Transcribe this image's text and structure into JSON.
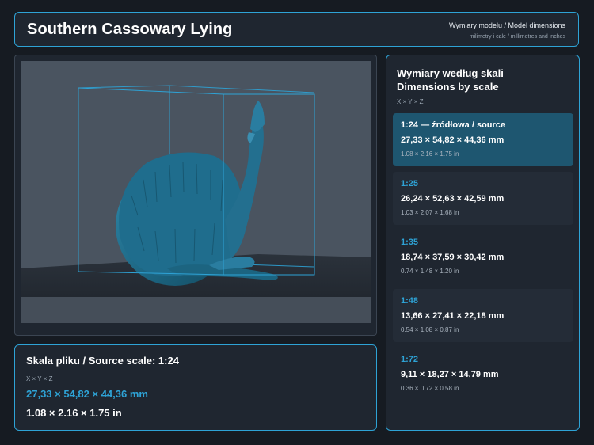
{
  "header": {
    "title": "Southern Cassowary Lying",
    "subtitle": "Wymiary modelu / Model dimensions",
    "units_note": "milimetry i cale / millimetres and inches"
  },
  "viewer": {
    "subject": "cassowary-model",
    "bbox_color": "#2ea3d6",
    "model_color": "#1d6e8c"
  },
  "source_scale": {
    "title": "Skala pliku / Source scale: 1:24",
    "axes": "X × Y × Z",
    "mm": "27,33 × 54,82 × 44,36 mm",
    "in": "1.08 × 2.16 × 1.75 in"
  },
  "scales_panel": {
    "title_pl": "Wymiary według skali",
    "title_en": "Dimensions by scale",
    "axes": "X × Y × Z",
    "items": [
      {
        "label": "1:24  —  źródłowa / source",
        "mm": "27,33 × 54,82 × 44,36 mm",
        "in": "1.08 × 2.16 × 1.75 in",
        "active": true
      },
      {
        "label": "1:25",
        "mm": "26,24 × 52,63 × 42,59 mm",
        "in": "1.03 × 2.07 × 1.68 in",
        "active": false
      },
      {
        "label": "1:35",
        "mm": "18,74 × 37,59 × 30,42 mm",
        "in": "0.74 × 1.48 × 1.20 in",
        "active": false
      },
      {
        "label": "1:48",
        "mm": "13,66 × 27,41 × 22,18 mm",
        "in": "0.54 × 1.08 × 0.87 in",
        "active": false
      },
      {
        "label": "1:72",
        "mm": "9,11 × 18,27 × 14,79 mm",
        "in": "0.36 × 0.72 × 0.58 in",
        "active": false
      }
    ]
  },
  "colors": {
    "accent": "#2ea3d6",
    "background": "#161b22",
    "panel": "#1f2630",
    "active_card": "#1e5670"
  }
}
